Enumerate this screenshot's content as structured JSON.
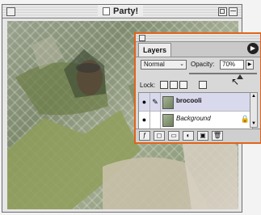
{
  "document": {
    "title": "Party!"
  },
  "layers_palette": {
    "tab_label": "Layers",
    "blend_mode": "Normal",
    "opacity_label": "Opacity:",
    "opacity_value": "70%",
    "lock_label": "Lock:",
    "layers": [
      {
        "name": "brocooli",
        "selected": true
      },
      {
        "name": "Background",
        "selected": false,
        "locked": true
      }
    ]
  },
  "icons": {
    "palette_menu": "palette-menu-icon",
    "eye": "eye-icon",
    "brush": "brush-icon",
    "lock": "lock-icon",
    "cursor": "cursor-icon"
  }
}
